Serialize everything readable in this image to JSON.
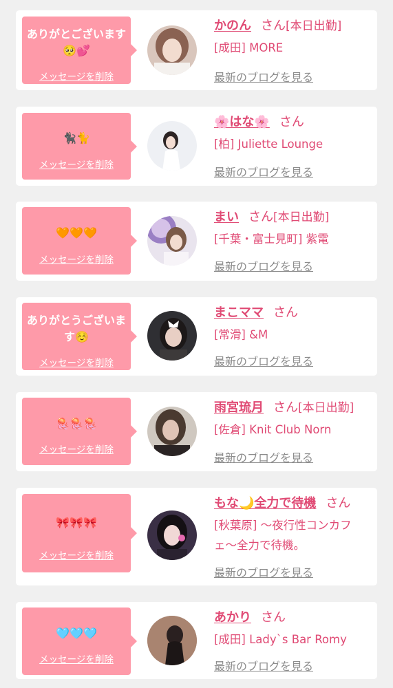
{
  "common": {
    "delete_label": "メッセージを削除",
    "san_label": "さん",
    "blog_label": "最新のブログを見る"
  },
  "colors": {
    "bubble": "#fe9aa9",
    "accent": "#e04a74",
    "link_gray": "#8c8c8c",
    "background": "#f0f0f0"
  },
  "cards": [
    {
      "message": "ありがとございます🥺💕",
      "name": "かのん",
      "status": "[本日出勤]",
      "shop": "[成田] MORE"
    },
    {
      "message": "🐈‍⬛🐈",
      "name": "🌸はな🌸",
      "status": "",
      "shop": "[柏] Juliette Lounge"
    },
    {
      "message": "🧡🧡🧡",
      "name": "まい",
      "status": "[本日出勤]",
      "shop": "[千葉・富士見町] 紫電"
    },
    {
      "message": "ありがとうございます☺️",
      "name": "まこママ",
      "status": "",
      "shop": "[常滑] &M"
    },
    {
      "message": "🪼🪼🪼",
      "name": "雨宮琉月",
      "status": "[本日出勤]",
      "shop": "[佐倉] Knit Club Norn"
    },
    {
      "message": "🎀🎀🎀",
      "name": "もな🌙全力で待機",
      "status": "",
      "shop": "[秋葉原] 〜夜行性コンカフェ〜全力で待機。"
    },
    {
      "message": "🩵🩵🩵",
      "name": "あかり",
      "status": "",
      "shop": "[成田] Lady`s Bar Romy"
    }
  ]
}
